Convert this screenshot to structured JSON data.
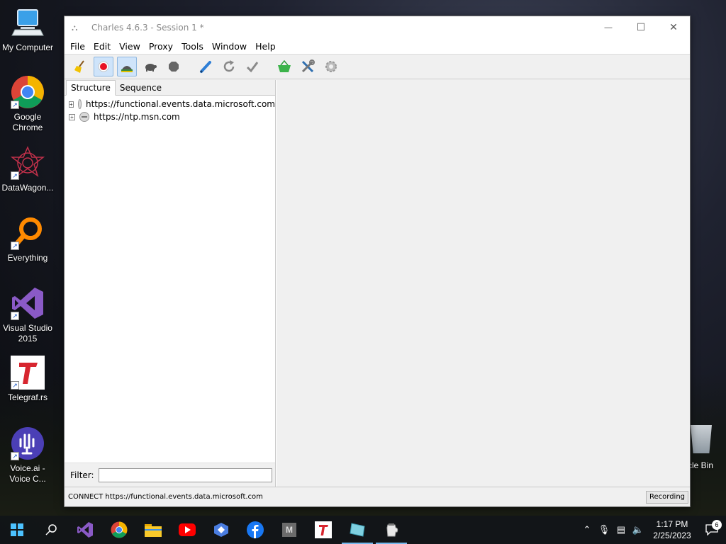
{
  "desktop": {
    "icons": [
      {
        "label": "My Computer",
        "icon": "computer-icon"
      },
      {
        "label": "Google Chrome",
        "icon": "chrome-icon"
      },
      {
        "label": "DataWagon...",
        "icon": "datawagon-icon"
      },
      {
        "label": "Everything",
        "icon": "everything-search-icon"
      },
      {
        "label": "Visual Studio 2015",
        "icon": "visual-studio-icon"
      },
      {
        "label": "Telegraf.rs",
        "icon": "telegraf-icon"
      },
      {
        "label": "Voice.ai - Voice C...",
        "icon": "voice-ai-icon"
      }
    ],
    "recycle_bin_label": "cle Bin"
  },
  "window": {
    "title": "Charles 4.6.3 - Session 1 *",
    "controls": {
      "minimize": "—",
      "maximize": "☐",
      "close": "✕"
    },
    "menu": [
      "File",
      "Edit",
      "View",
      "Proxy",
      "Tools",
      "Window",
      "Help"
    ],
    "toolbar": [
      {
        "name": "broom-icon",
        "tooltip": "Clear"
      },
      {
        "name": "record-icon",
        "active": true
      },
      {
        "name": "throttle-icon",
        "active": true
      },
      {
        "name": "turtle-icon"
      },
      {
        "name": "stop-hexagon-icon"
      },
      {
        "name": "pen-icon"
      },
      {
        "name": "refresh-icon"
      },
      {
        "name": "checkmark-icon"
      },
      {
        "name": "basket-icon"
      },
      {
        "name": "tools-icon"
      },
      {
        "name": "settings-gear-icon"
      }
    ],
    "tabs": {
      "structure": "Structure",
      "sequence": "Sequence"
    },
    "hosts": [
      "https://functional.events.data.microsoft.com",
      "https://ntp.msn.com"
    ],
    "filter": {
      "label": "Filter:",
      "value": ""
    },
    "status": {
      "text": "CONNECT https://functional.events.data.microsoft.com",
      "badge": "Recording"
    }
  },
  "taskbar": {
    "apps": [
      "start-windows-icon",
      "search-icon",
      "visual-studio-icon",
      "chrome-icon",
      "file-explorer-icon",
      "youtube-icon",
      "screenshot-app-icon",
      "facebook-icon",
      "m-app-icon",
      "telegraf-icon",
      "charles-taskbar-icon",
      "charles-jug-icon"
    ],
    "clock": {
      "time": "1:17 PM",
      "date": "2/25/2023"
    },
    "notifications": "6"
  },
  "colors": {
    "accent": "#0078d7",
    "record": "#e81123",
    "taskbar": "#12161a"
  }
}
